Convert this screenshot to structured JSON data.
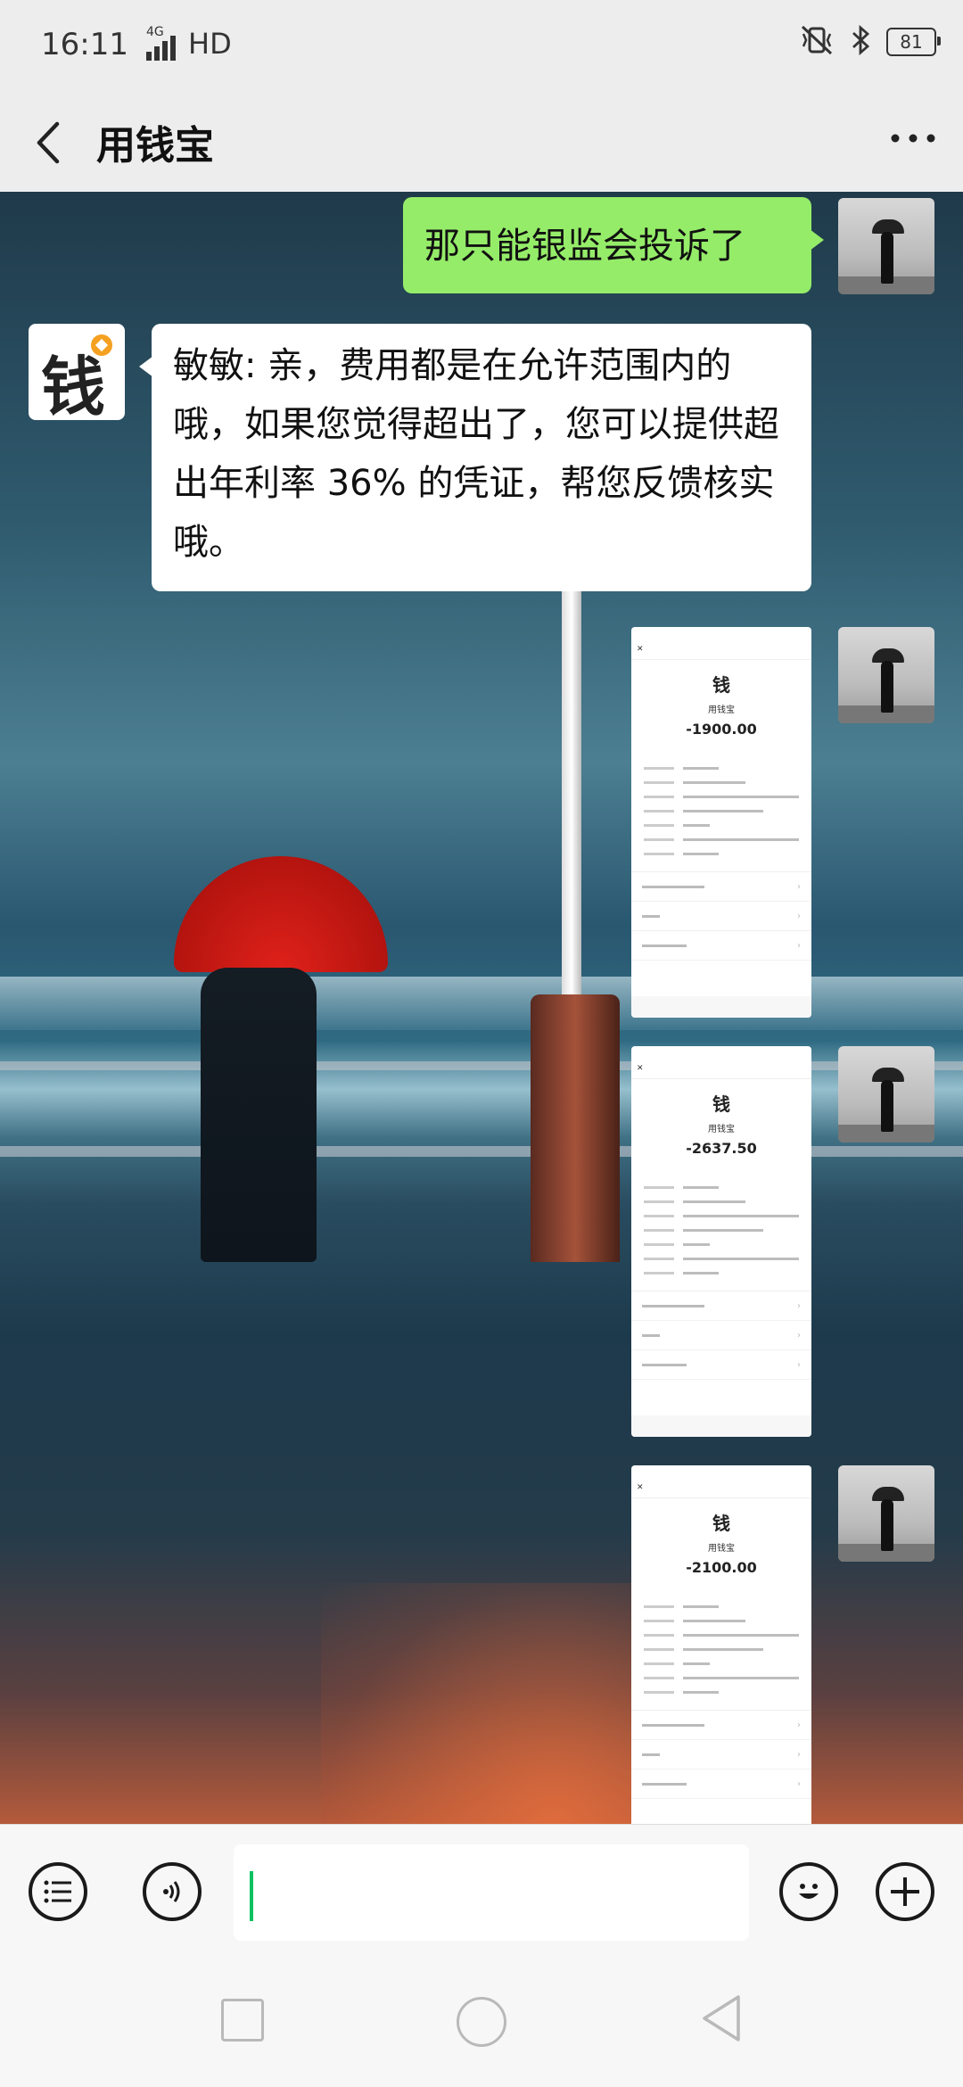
{
  "status_bar": {
    "time": "16:11",
    "network": "4G",
    "hd": "HD",
    "battery": "81"
  },
  "header": {
    "title": "用钱宝",
    "back_icon": "chevron-left-icon",
    "more_icon": "more-dots-icon"
  },
  "messages": [
    {
      "side": "right",
      "type": "text",
      "text": "那只能银监会投诉了"
    },
    {
      "side": "left",
      "type": "text",
      "text": "敏敏: 亲，费用都是在允许范围内的哦，如果您觉得超出了，您可以提供超出年利率 36% 的凭证，帮您反馈核实哦。"
    }
  ],
  "bot_avatar": {
    "glyph": "钱",
    "accent": "#f5a020"
  },
  "receipts": [
    {
      "logo": "钱",
      "name": "用钱宝",
      "amount": "-1900.00"
    },
    {
      "logo": "钱",
      "name": "用钱宝",
      "amount": "-2637.50"
    },
    {
      "logo": "钱",
      "name": "用钱宝",
      "amount": "-2100.00"
    }
  ],
  "input_bar": {
    "menu_icon": "list-icon",
    "voice_icon": "voice-icon",
    "input_value": "",
    "emoji_icon": "emoji-icon",
    "add_icon": "plus-icon"
  },
  "colors": {
    "bubble_outgoing": "#95ec69",
    "bubble_incoming": "#ffffff",
    "caret": "#07c160"
  }
}
